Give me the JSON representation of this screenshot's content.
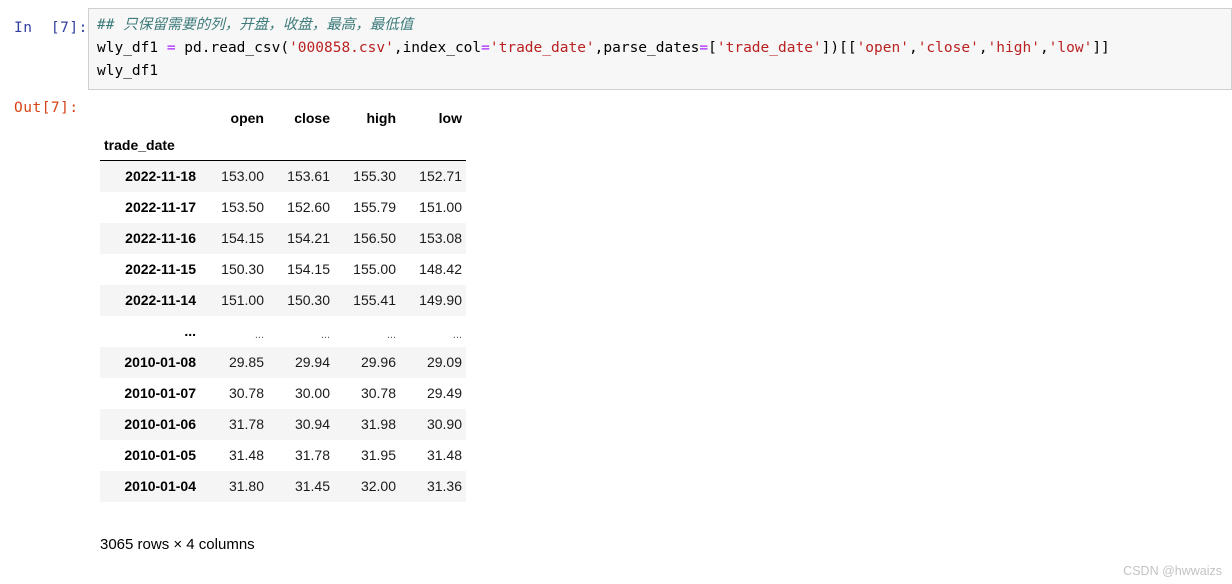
{
  "input_cell": {
    "prompt": "In  [7]:",
    "code_lines": [
      [
        {
          "t": "comment",
          "s": "## 只保留需要的列，开盘，收盘，最高，最低值"
        }
      ],
      [
        {
          "t": "plain",
          "s": "wly_df1 "
        },
        {
          "t": "op",
          "s": "="
        },
        {
          "t": "plain",
          "s": " pd.read_csv("
        },
        {
          "t": "str",
          "s": "'000858.csv'"
        },
        {
          "t": "plain",
          "s": ",index_col"
        },
        {
          "t": "op",
          "s": "="
        },
        {
          "t": "str",
          "s": "'trade_date'"
        },
        {
          "t": "plain",
          "s": ",parse_dates"
        },
        {
          "t": "op",
          "s": "="
        },
        {
          "t": "plain",
          "s": "["
        },
        {
          "t": "str",
          "s": "'trade_date'"
        },
        {
          "t": "plain",
          "s": "])[["
        },
        {
          "t": "str",
          "s": "'open'"
        },
        {
          "t": "plain",
          "s": ","
        },
        {
          "t": "str",
          "s": "'close'"
        },
        {
          "t": "plain",
          "s": ","
        },
        {
          "t": "str",
          "s": "'high'"
        },
        {
          "t": "plain",
          "s": ","
        },
        {
          "t": "str",
          "s": "'low'"
        },
        {
          "t": "plain",
          "s": "]]"
        }
      ],
      [
        {
          "t": "plain",
          "s": "wly_df1"
        }
      ]
    ]
  },
  "output_cell": {
    "prompt": "Out[7]:",
    "dataframe": {
      "index_name": "trade_date",
      "columns": [
        "open",
        "close",
        "high",
        "low"
      ],
      "rows": [
        {
          "index": "2022-11-18",
          "values": [
            "153.00",
            "153.61",
            "155.30",
            "152.71"
          ]
        },
        {
          "index": "2022-11-17",
          "values": [
            "153.50",
            "152.60",
            "155.79",
            "151.00"
          ]
        },
        {
          "index": "2022-11-16",
          "values": [
            "154.15",
            "154.21",
            "156.50",
            "153.08"
          ]
        },
        {
          "index": "2022-11-15",
          "values": [
            "150.30",
            "154.15",
            "155.00",
            "148.42"
          ]
        },
        {
          "index": "2022-11-14",
          "values": [
            "151.00",
            "150.30",
            "155.41",
            "149.90"
          ]
        },
        {
          "index": "...",
          "values": [
            "...",
            "...",
            "...",
            "..."
          ],
          "ellipsis": true
        },
        {
          "index": "2010-01-08",
          "values": [
            "29.85",
            "29.94",
            "29.96",
            "29.09"
          ]
        },
        {
          "index": "2010-01-07",
          "values": [
            "30.78",
            "30.00",
            "30.78",
            "29.49"
          ]
        },
        {
          "index": "2010-01-06",
          "values": [
            "31.78",
            "30.94",
            "31.98",
            "30.90"
          ]
        },
        {
          "index": "2010-01-05",
          "values": [
            "31.48",
            "31.78",
            "31.95",
            "31.48"
          ]
        },
        {
          "index": "2010-01-04",
          "values": [
            "31.80",
            "31.45",
            "32.00",
            "31.36"
          ]
        }
      ],
      "shape_text": "3065 rows × 4 columns"
    }
  },
  "watermark": "CSDN @hwwaizs",
  "colors": {
    "prompt_in": "#303f9f",
    "prompt_out": "#d84315",
    "comment": "#3d7b7b",
    "string": "#ba2121",
    "operator": "#aa22ff",
    "cell_bg": "#f7f7f7",
    "cell_border": "#cfcfcf",
    "row_stripe": "#f5f5f5"
  }
}
